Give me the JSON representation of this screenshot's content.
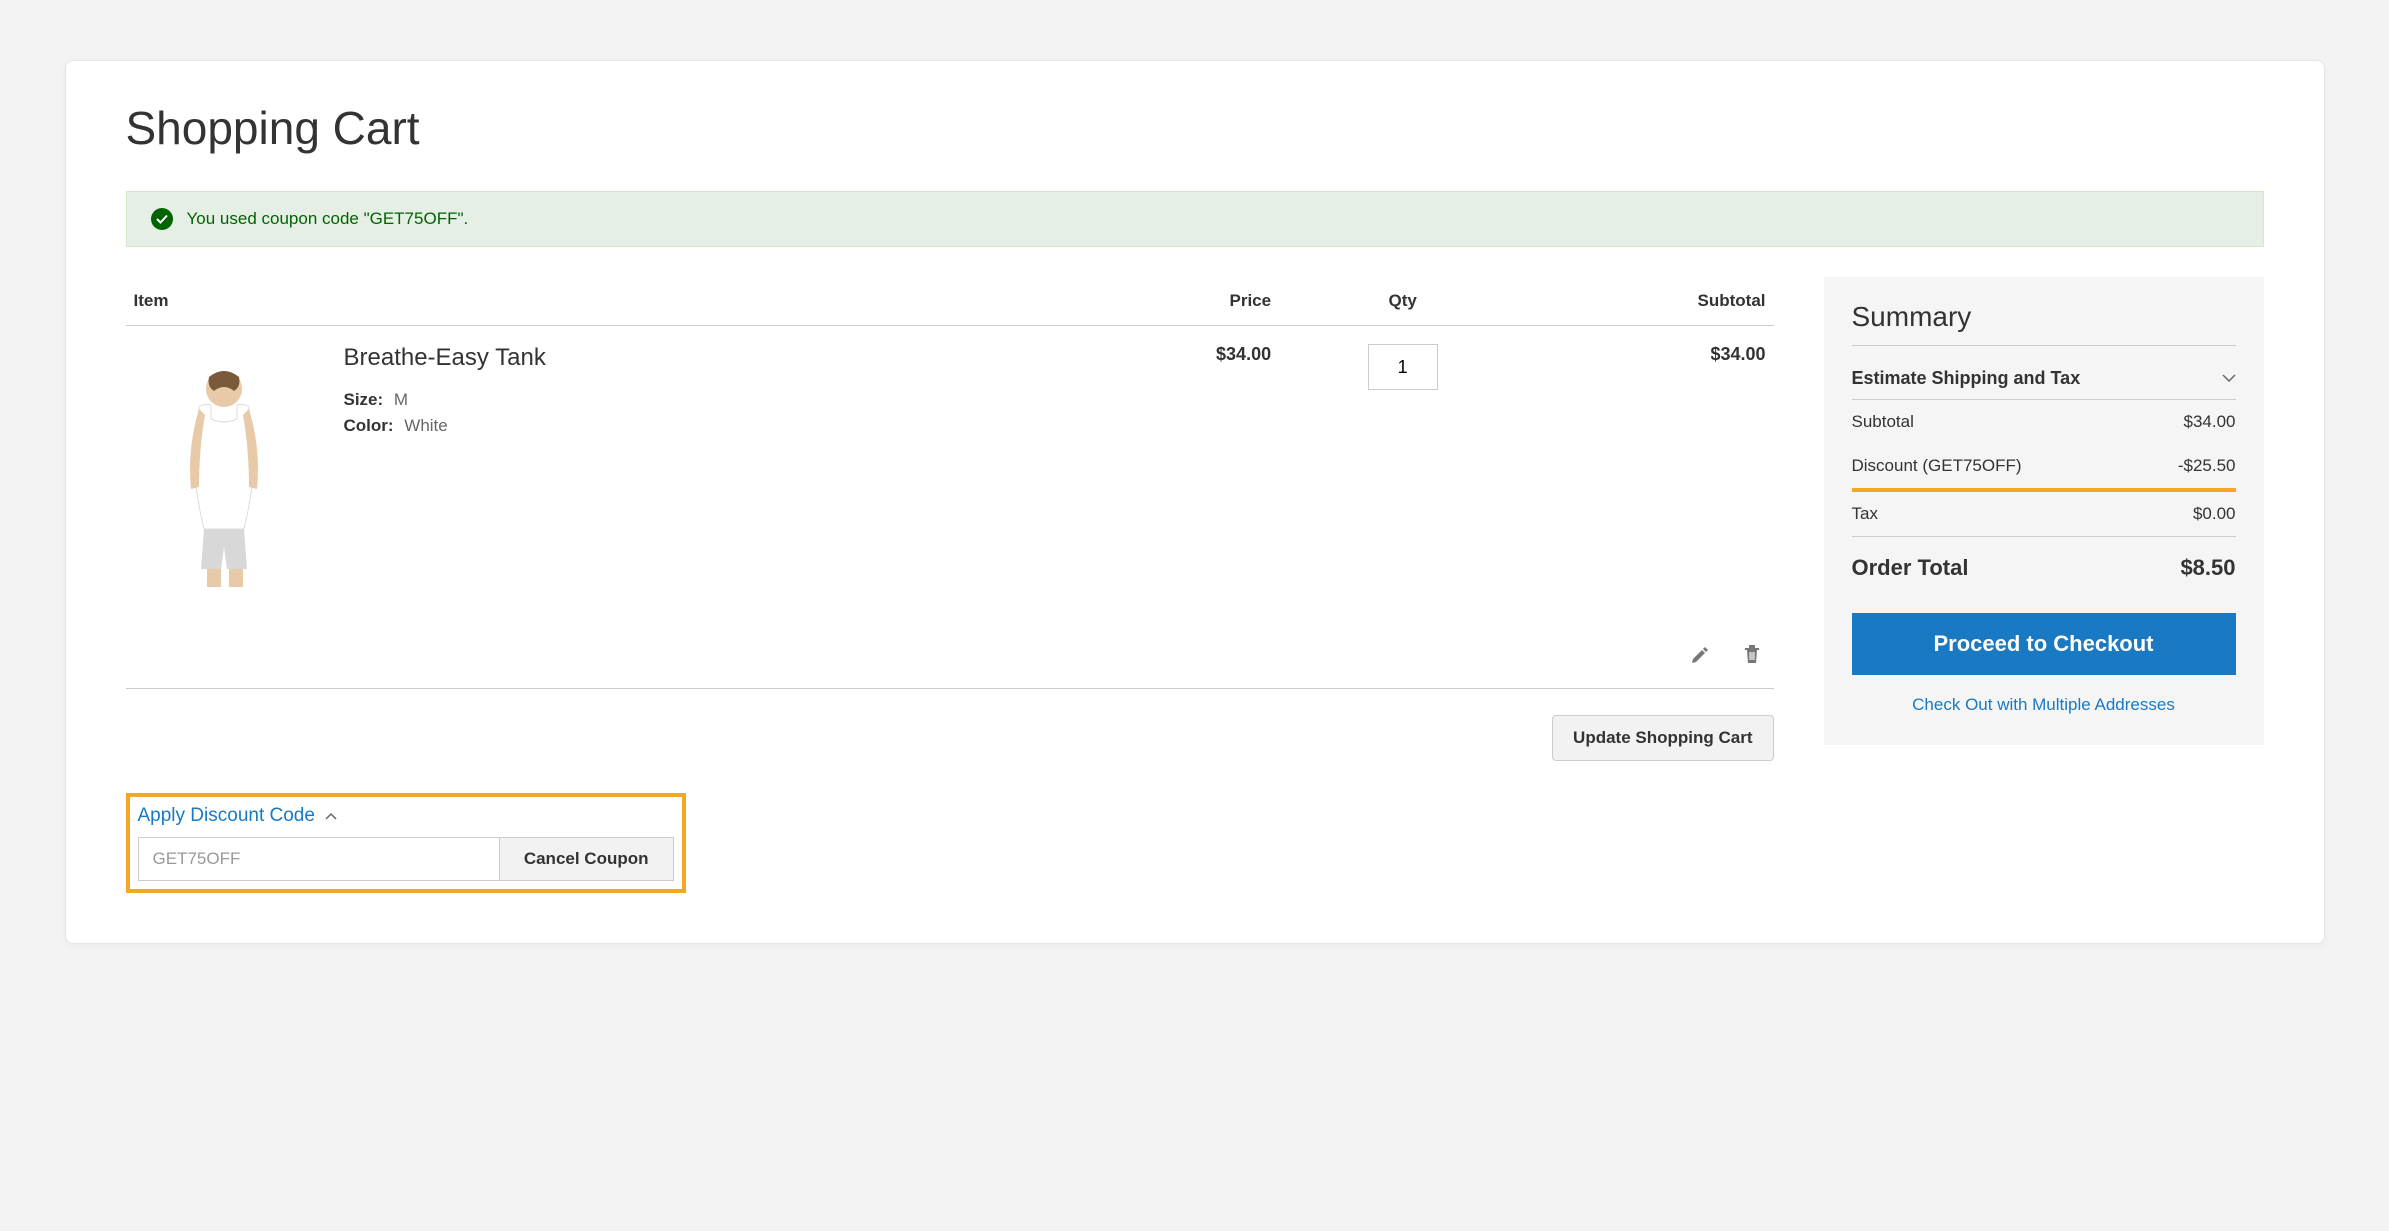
{
  "page_title": "Shopping Cart",
  "alert": {
    "message": "You used coupon code \"GET75OFF\"."
  },
  "table": {
    "headers": {
      "item": "Item",
      "price": "Price",
      "qty": "Qty",
      "subtotal": "Subtotal"
    },
    "item": {
      "name": "Breathe-Easy Tank",
      "size_label": "Size:",
      "size_value": "M",
      "color_label": "Color:",
      "color_value": "White",
      "price": "$34.00",
      "qty": "1",
      "subtotal": "$34.00"
    },
    "update_button": "Update Shopping Cart"
  },
  "discount": {
    "toggle_label": "Apply Discount Code",
    "input_value": "GET75OFF",
    "cancel_button": "Cancel Coupon"
  },
  "summary": {
    "title": "Summary",
    "estimate_toggle": "Estimate Shipping and Tax",
    "subtotal_label": "Subtotal",
    "subtotal_value": "$34.00",
    "discount_label": "Discount (GET75OFF)",
    "discount_value": "-$25.50",
    "tax_label": "Tax",
    "tax_value": "$0.00",
    "total_label": "Order Total",
    "total_value": "$8.50",
    "checkout_button": "Proceed to Checkout",
    "multi_address_link": "Check Out with Multiple Addresses"
  }
}
